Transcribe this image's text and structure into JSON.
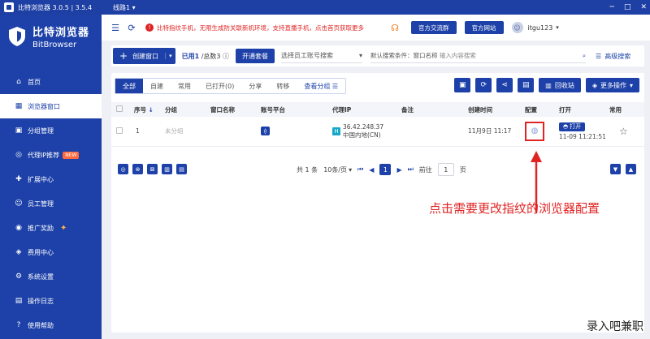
{
  "titlebar": {
    "title": "比特浏览器 3.0.5 | 3.5.4",
    "route": "线路1"
  },
  "sidebar": {
    "logo_cn": "比特浏览器",
    "logo_en": "BitBrowser",
    "items": [
      {
        "label": "首页",
        "icon": "home-icon"
      },
      {
        "label": "浏览器窗口",
        "icon": "window-grid-icon",
        "active": true
      },
      {
        "label": "分组管理",
        "icon": "group-icon"
      },
      {
        "label": "代理IP推荐",
        "icon": "proxy-icon",
        "badge": "NEW"
      },
      {
        "label": "扩展中心",
        "icon": "extension-icon"
      },
      {
        "label": "员工管理",
        "icon": "staff-icon"
      },
      {
        "label": "推广奖励",
        "icon": "reward-icon"
      },
      {
        "label": "费用中心",
        "icon": "fee-icon"
      },
      {
        "label": "系统设置",
        "icon": "settings-icon"
      },
      {
        "label": "操作日志",
        "icon": "log-icon"
      },
      {
        "label": "使用帮助",
        "icon": "help-icon"
      }
    ]
  },
  "header": {
    "notice": "比特指纹手机，无限生成防关联新机环境，支持直播手机，点击首页获取更多",
    "exchange_group": "官方交流群",
    "official_site": "官方网站",
    "user": "itgu123"
  },
  "toolbar": {
    "create": "创建窗口",
    "used_label": "已用1",
    "total_label": "/总数3",
    "open_package": "开通套餐",
    "staff_placeholder": "选择员工账号搜索",
    "search_default": "默认搜索条件：窗口名称",
    "search_placeholder": "输入内容搜索",
    "advanced": "高级搜索"
  },
  "tabs": [
    "全部",
    "自建",
    "常用",
    "已打开(0)",
    "分享",
    "转移",
    "查看分组"
  ],
  "tools": {
    "recycle": "回收站",
    "more": "更多操作"
  },
  "table": {
    "headers": [
      "序号",
      "分组",
      "窗口名称",
      "账号平台",
      "代理IP",
      "备注",
      "创建时间",
      "配置",
      "打开",
      "常用"
    ],
    "rows": [
      {
        "index": "1",
        "group": "未分组",
        "name": "",
        "ip": "36.42.248.37",
        "ip_region": "中国内地(CN)",
        "note": "",
        "created": "11月9日 11:17",
        "open_label": "打开",
        "open_time": "11-09 11:21:51"
      }
    ]
  },
  "pager": {
    "total": "共 1 条",
    "per_page": "10条/页",
    "current": "1",
    "goto": "前往",
    "goto_value": "1",
    "page_unit": "页"
  },
  "annotation": "点击需要更改指纹的浏览器配置",
  "watermark": "录入吧兼职",
  "colors": {
    "brand": "#1d41a8",
    "annotation": "#e02424"
  }
}
